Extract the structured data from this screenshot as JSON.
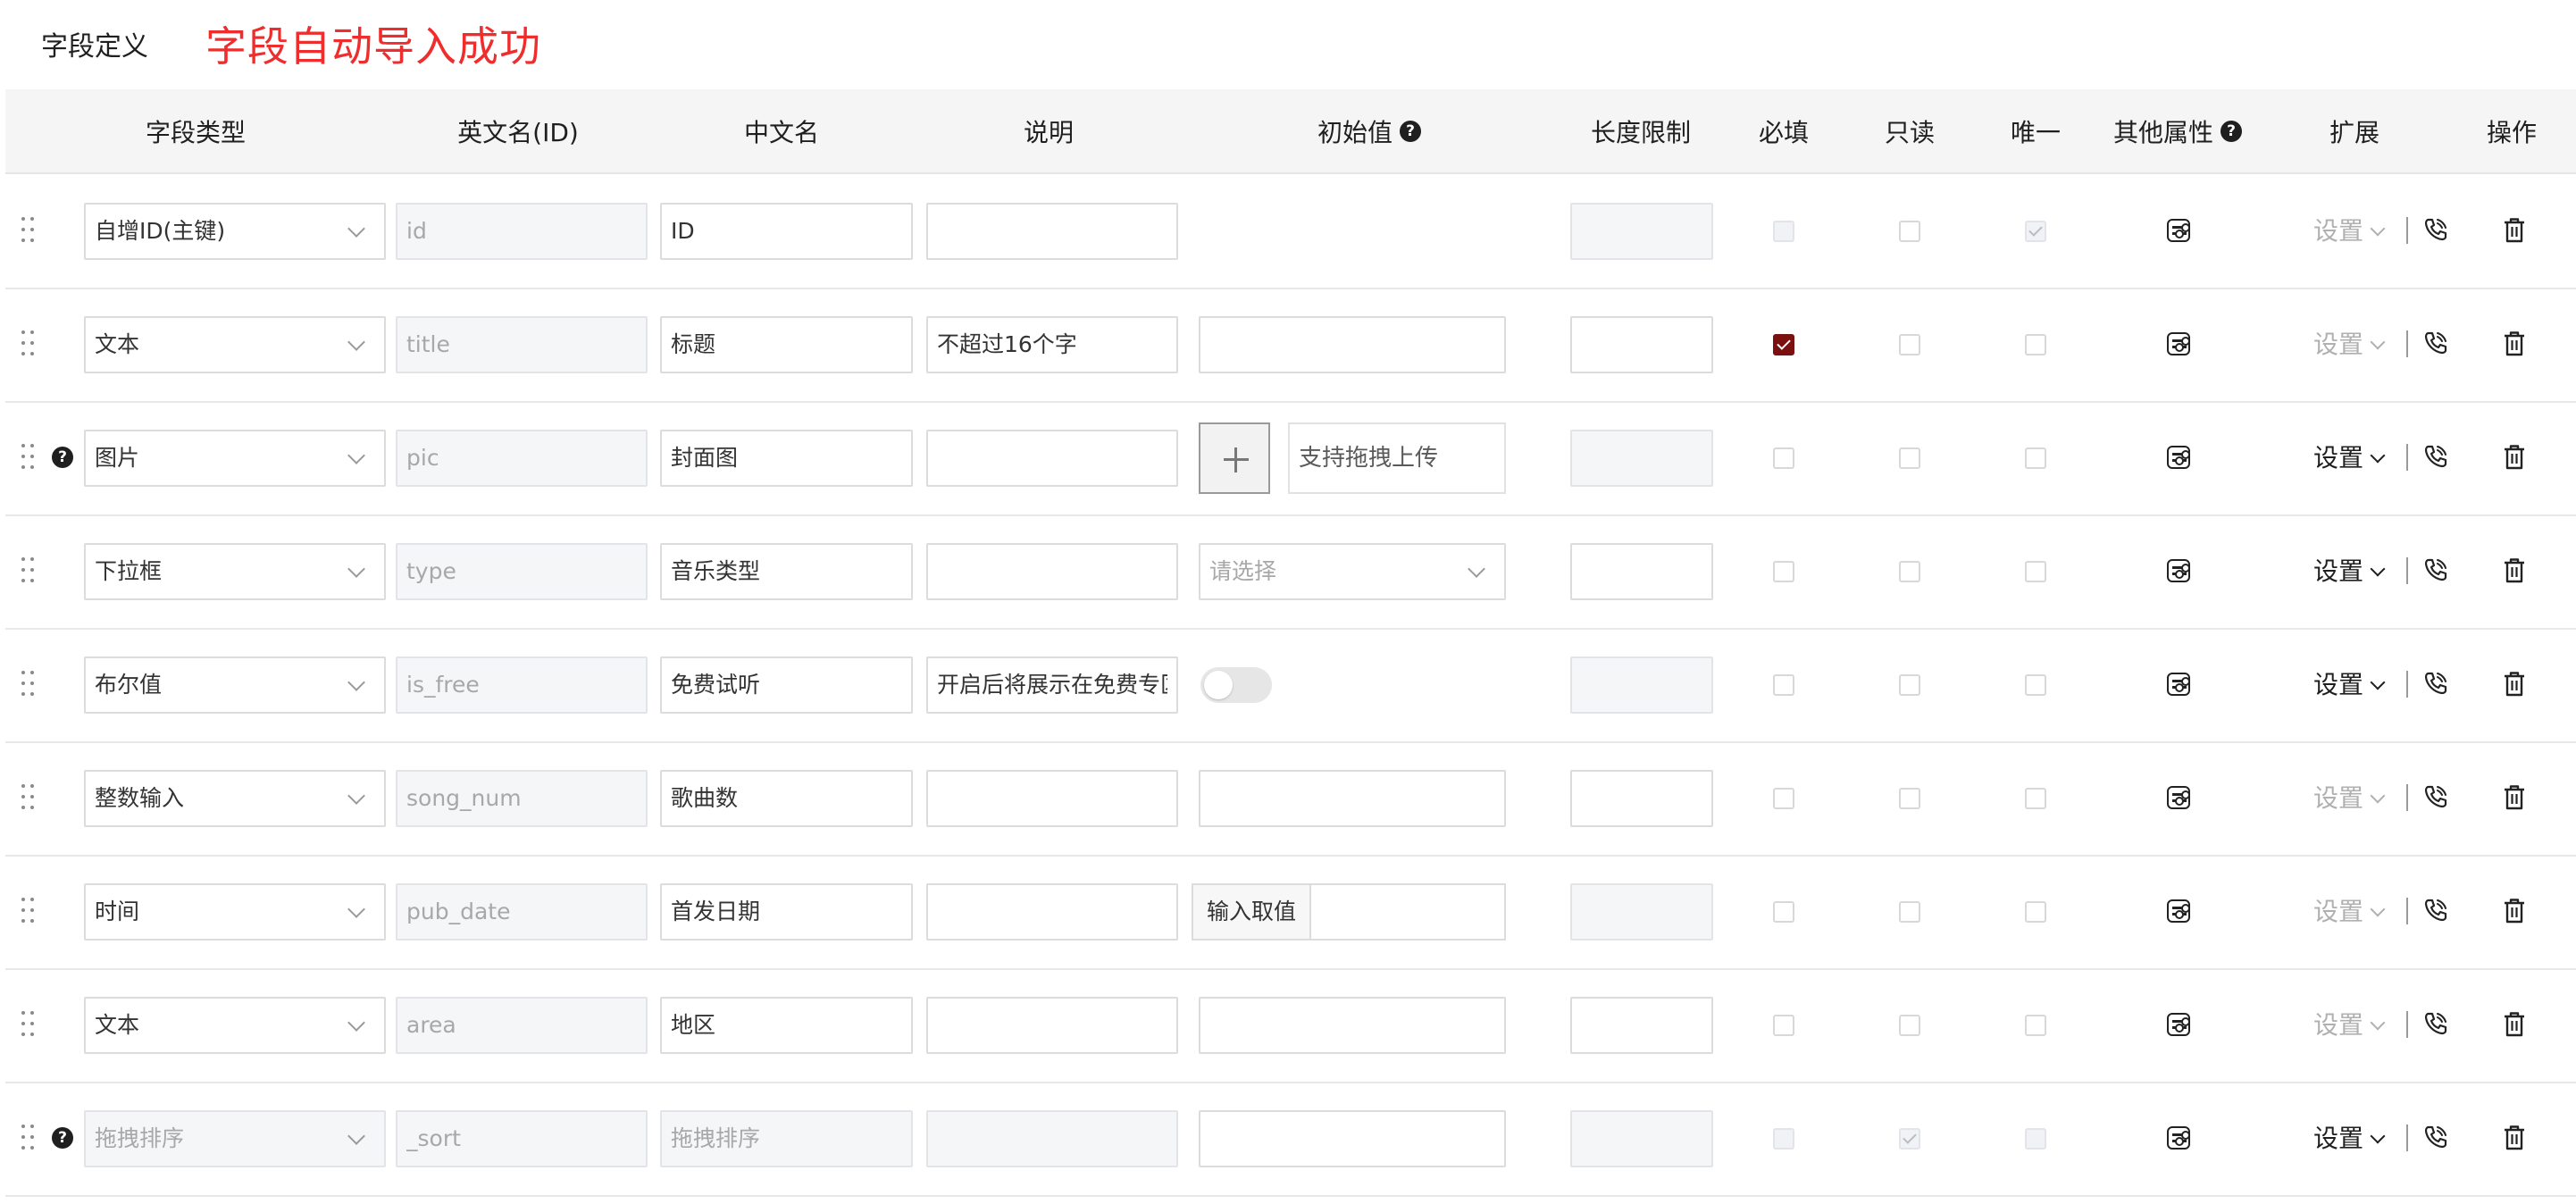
{
  "header": {
    "section_title": "字段定义",
    "notice": "字段自动导入成功"
  },
  "columns": {
    "type": "字段类型",
    "en_name": "英文名(ID)",
    "cn_name": "中文名",
    "desc": "说明",
    "default": "初始值",
    "max_len": "长度限制",
    "required": "必填",
    "readonly": "只读",
    "unique": "唯一",
    "other_attrs": "其他属性",
    "extend": "扩展",
    "actions": "操作"
  },
  "rows": [
    {
      "type": "自增ID(主键)",
      "en_name": "id",
      "cn_name": "ID",
      "desc": "",
      "help": false,
      "default_kind": "none",
      "default_text": "",
      "len_disabled": true,
      "type_disabled": false,
      "cn_disabled": false,
      "desc_disabled": false,
      "required": "disabled",
      "readonly": "off",
      "unique": "checked-disabled",
      "setting_label": "设置",
      "setting_enabled": false
    },
    {
      "type": "文本",
      "en_name": "title",
      "cn_name": "标题",
      "desc": "不超过16个字",
      "help": false,
      "default_kind": "input",
      "default_text": "",
      "len_disabled": false,
      "type_disabled": false,
      "cn_disabled": false,
      "desc_disabled": false,
      "required": "on",
      "readonly": "off",
      "unique": "off",
      "setting_label": "设置",
      "setting_enabled": false
    },
    {
      "type": "图片",
      "en_name": "pic",
      "cn_name": "封面图",
      "desc": "",
      "help": true,
      "default_kind": "upload",
      "default_text": "支持拖拽上传",
      "len_disabled": true,
      "type_disabled": false,
      "cn_disabled": false,
      "desc_disabled": false,
      "required": "off",
      "readonly": "off",
      "unique": "off",
      "setting_label": "设置",
      "setting_enabled": true
    },
    {
      "type": "下拉框",
      "en_name": "type",
      "cn_name": "音乐类型",
      "desc": "",
      "help": false,
      "default_kind": "select",
      "default_text": "请选择",
      "len_disabled": false,
      "type_disabled": false,
      "cn_disabled": false,
      "desc_disabled": false,
      "required": "off",
      "readonly": "off",
      "unique": "off",
      "setting_label": "设置",
      "setting_enabled": true
    },
    {
      "type": "布尔值",
      "en_name": "is_free",
      "cn_name": "免费试听",
      "desc": "开启后将展示在免费专区",
      "help": false,
      "default_kind": "toggle",
      "default_text": "",
      "len_disabled": true,
      "type_disabled": false,
      "cn_disabled": false,
      "desc_disabled": false,
      "required": "off",
      "readonly": "off",
      "unique": "off",
      "setting_label": "设置",
      "setting_enabled": true
    },
    {
      "type": "整数输入",
      "en_name": "song_num",
      "cn_name": "歌曲数",
      "desc": "",
      "help": false,
      "default_kind": "input",
      "default_text": "",
      "len_disabled": false,
      "type_disabled": false,
      "cn_disabled": false,
      "desc_disabled": false,
      "required": "off",
      "readonly": "off",
      "unique": "off",
      "setting_label": "设置",
      "setting_enabled": false
    },
    {
      "type": "时间",
      "en_name": "pub_date",
      "cn_name": "首发日期",
      "desc": "",
      "help": false,
      "default_kind": "prefixed",
      "default_text": "输入取值",
      "len_disabled": true,
      "type_disabled": false,
      "cn_disabled": false,
      "desc_disabled": false,
      "required": "off",
      "readonly": "off",
      "unique": "off",
      "setting_label": "设置",
      "setting_enabled": false
    },
    {
      "type": "文本",
      "en_name": "area",
      "cn_name": "地区",
      "desc": "",
      "help": false,
      "default_kind": "input",
      "default_text": "",
      "len_disabled": false,
      "type_disabled": false,
      "cn_disabled": false,
      "desc_disabled": false,
      "required": "off",
      "readonly": "off",
      "unique": "off",
      "setting_label": "设置",
      "setting_enabled": false
    },
    {
      "type": "拖拽排序",
      "en_name": "_sort",
      "cn_name": "拖拽排序",
      "desc": "",
      "help": true,
      "default_kind": "input",
      "default_text": "",
      "len_disabled": true,
      "type_disabled": true,
      "cn_disabled": true,
      "desc_disabled": true,
      "required": "disabled",
      "readonly": "checked-disabled",
      "unique": "disabled",
      "setting_label": "设置",
      "setting_enabled": true
    }
  ],
  "colors": {
    "notice": "#ef2d2d",
    "checked": "#7a1010",
    "header_bg": "#f5f5f5"
  },
  "icons": {
    "drag": "drag-handle-icon",
    "help": "question-circle-icon",
    "chevron": "chevron-down-icon",
    "attrs": "settings-sliders-icon",
    "hook": "phone-hook-icon",
    "delete": "trash-icon",
    "upload": "plus-icon"
  }
}
